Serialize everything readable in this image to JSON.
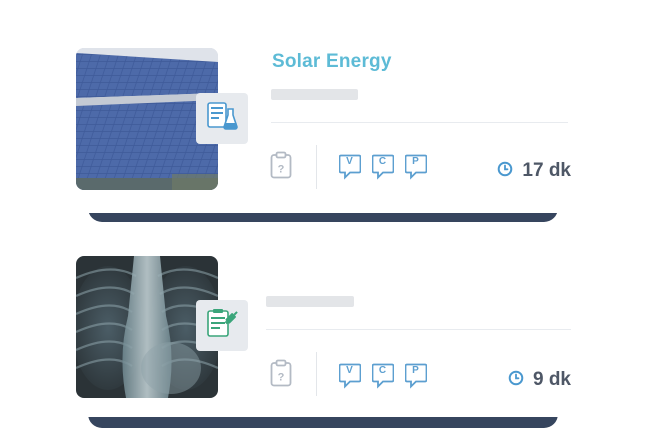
{
  "cards": [
    {
      "title": "Solar Energy",
      "duration": "17 dk",
      "thumbnail": "solar-panels-photo",
      "badge_icon": "document-flask-icon",
      "tags": [
        "V",
        "C",
        "P"
      ]
    },
    {
      "title": "",
      "duration": "9 dk",
      "thumbnail": "chest-xray-photo",
      "badge_icon": "document-syringe-icon",
      "tags": [
        "V",
        "C",
        "P"
      ]
    }
  ],
  "colors": {
    "title": "#5dbbd6",
    "accent": "#5c9fd0",
    "shadow": "#36455e",
    "duration_text": "#4e5766"
  }
}
